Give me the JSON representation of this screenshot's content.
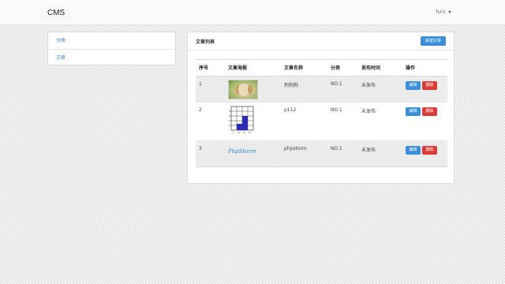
{
  "app": {
    "brand": "CMS",
    "user": "fvnc"
  },
  "sidebar": {
    "items": [
      {
        "label": "分类"
      },
      {
        "label": "文章"
      }
    ]
  },
  "panel": {
    "title": "文章列表",
    "new_button": "新建文章"
  },
  "table": {
    "columns": [
      "序号",
      "文章海报",
      "文章名称",
      "分类",
      "发布时间",
      "操作"
    ],
    "rows": [
      {
        "index": "1",
        "poster": "dog-photo",
        "name": "狗狗狗",
        "category": "NO.1",
        "publish": "未发布"
      },
      {
        "index": "2",
        "poster": "bar-chart-image",
        "name": "p112",
        "category": "NO.1",
        "publish": "未发布"
      },
      {
        "index": "3",
        "poster": "phpstorm-logo",
        "poster_text": "PhpStorm",
        "name": "phpstorm",
        "category": "NO.1",
        "publish": "未发布"
      }
    ],
    "edit_label": "编辑",
    "delete_label": "删除"
  },
  "colors": {
    "primary": "#3a8fd8",
    "danger": "#dc3b35",
    "link": "#3a86d1"
  }
}
